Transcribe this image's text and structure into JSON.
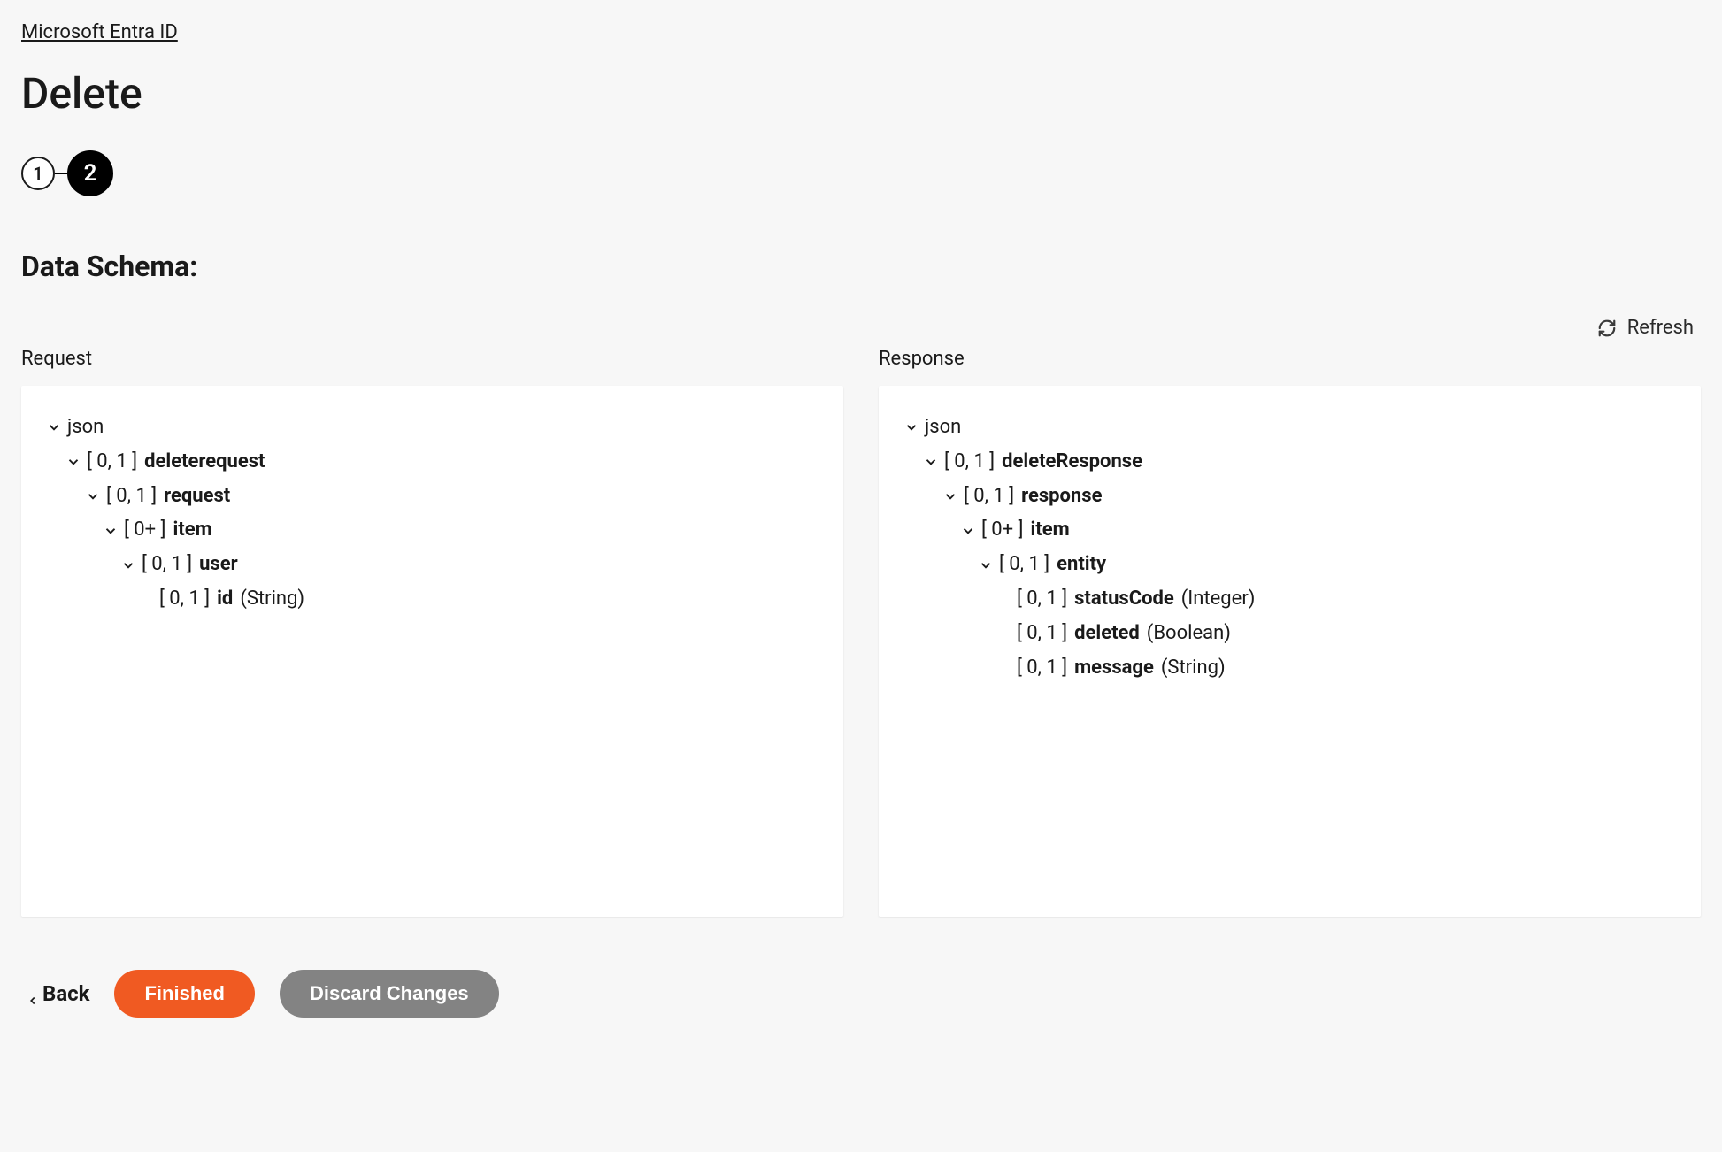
{
  "breadcrumb": "Microsoft Entra ID",
  "pageTitle": "Delete",
  "stepper": {
    "steps": [
      "1",
      "2"
    ],
    "activeIndex": 1
  },
  "sectionHeading": "Data Schema:",
  "refresh": {
    "label": "Refresh"
  },
  "columns": {
    "request": {
      "label": "Request",
      "root": "json",
      "nodes": {
        "n0": {
          "card": "[ 0, 1 ]",
          "name": "deleterequest"
        },
        "n1": {
          "card": "[ 0, 1 ]",
          "name": "request"
        },
        "n2": {
          "card": "[ 0+ ]",
          "name": "item"
        },
        "n3": {
          "card": "[ 0, 1 ]",
          "name": "user"
        },
        "n4": {
          "card": "[ 0, 1 ]",
          "name": "id",
          "type": "(String)"
        }
      }
    },
    "response": {
      "label": "Response",
      "root": "json",
      "nodes": {
        "n0": {
          "card": "[ 0, 1 ]",
          "name": "deleteResponse"
        },
        "n1": {
          "card": "[ 0, 1 ]",
          "name": "response"
        },
        "n2": {
          "card": "[ 0+ ]",
          "name": "item"
        },
        "n3": {
          "card": "[ 0, 1 ]",
          "name": "entity"
        },
        "n4": {
          "card": "[ 0, 1 ]",
          "name": "statusCode",
          "type": "(Integer)"
        },
        "n5": {
          "card": "[ 0, 1 ]",
          "name": "deleted",
          "type": "(Boolean)"
        },
        "n6": {
          "card": "[ 0, 1 ]",
          "name": "message",
          "type": "(String)"
        }
      }
    }
  },
  "footer": {
    "back": "Back",
    "finished": "Finished",
    "discard": "Discard Changes"
  }
}
